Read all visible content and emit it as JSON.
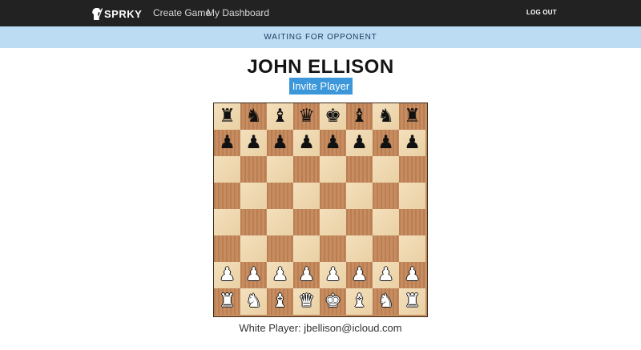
{
  "nav": {
    "logo_text": "SPRKY",
    "links": [
      "Create Game",
      "My Dashboard"
    ],
    "logout": "LOG OUT"
  },
  "status": "WAITING FOR OPPONENT",
  "player_name": "JOHN ELLISON",
  "invite_button": "Invite Player",
  "board": {
    "ranks": [
      [
        "br",
        "bn",
        "bb",
        "bq",
        "bk",
        "bb",
        "bn",
        "br"
      ],
      [
        "bp",
        "bp",
        "bp",
        "bp",
        "bp",
        "bp",
        "bp",
        "bp"
      ],
      [
        "",
        "",
        "",
        "",
        "",
        "",
        "",
        ""
      ],
      [
        "",
        "",
        "",
        "",
        "",
        "",
        "",
        ""
      ],
      [
        "",
        "",
        "",
        "",
        "",
        "",
        "",
        ""
      ],
      [
        "",
        "",
        "",
        "",
        "",
        "",
        "",
        ""
      ],
      [
        "wp",
        "wp",
        "wp",
        "wp",
        "wp",
        "wp",
        "wp",
        "wp"
      ],
      [
        "wr",
        "wn",
        "wb",
        "wq",
        "wk",
        "wb",
        "wn",
        "wr"
      ]
    ]
  },
  "white_player": "White Player: jbellison@icloud.com",
  "colors": {
    "navbar": "#222222",
    "status_bar": "#bcdcf4",
    "invite_button": "#3b97d9",
    "light_square": "#f1d9ae",
    "dark_square": "#c4875a"
  }
}
